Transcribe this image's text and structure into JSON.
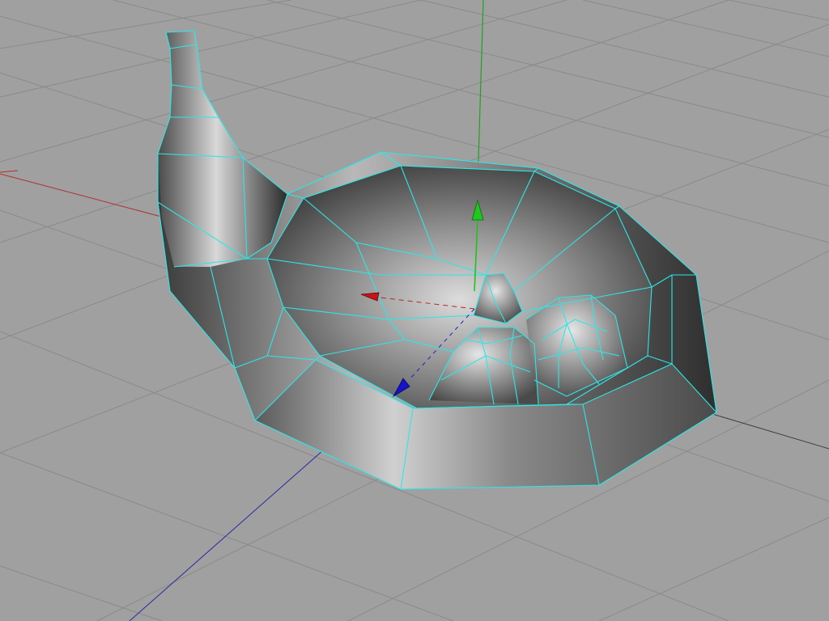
{
  "viewport": {
    "background": "#a0a0a0",
    "grid_color": "#8a8a8a",
    "wireframe_color": "#2ee6e6"
  },
  "axes": {
    "x_color": "#cc2222",
    "y_color": "#22aa22",
    "z_color": "#2222aa"
  },
  "gizmo": {
    "x_handle_color": "#c81414",
    "y_handle_color": "#1ec81e",
    "z_handle_color": "#1414c8",
    "icons": [
      "move-x-arrow-icon",
      "move-y-arrow-icon",
      "move-z-arrow-icon"
    ]
  }
}
